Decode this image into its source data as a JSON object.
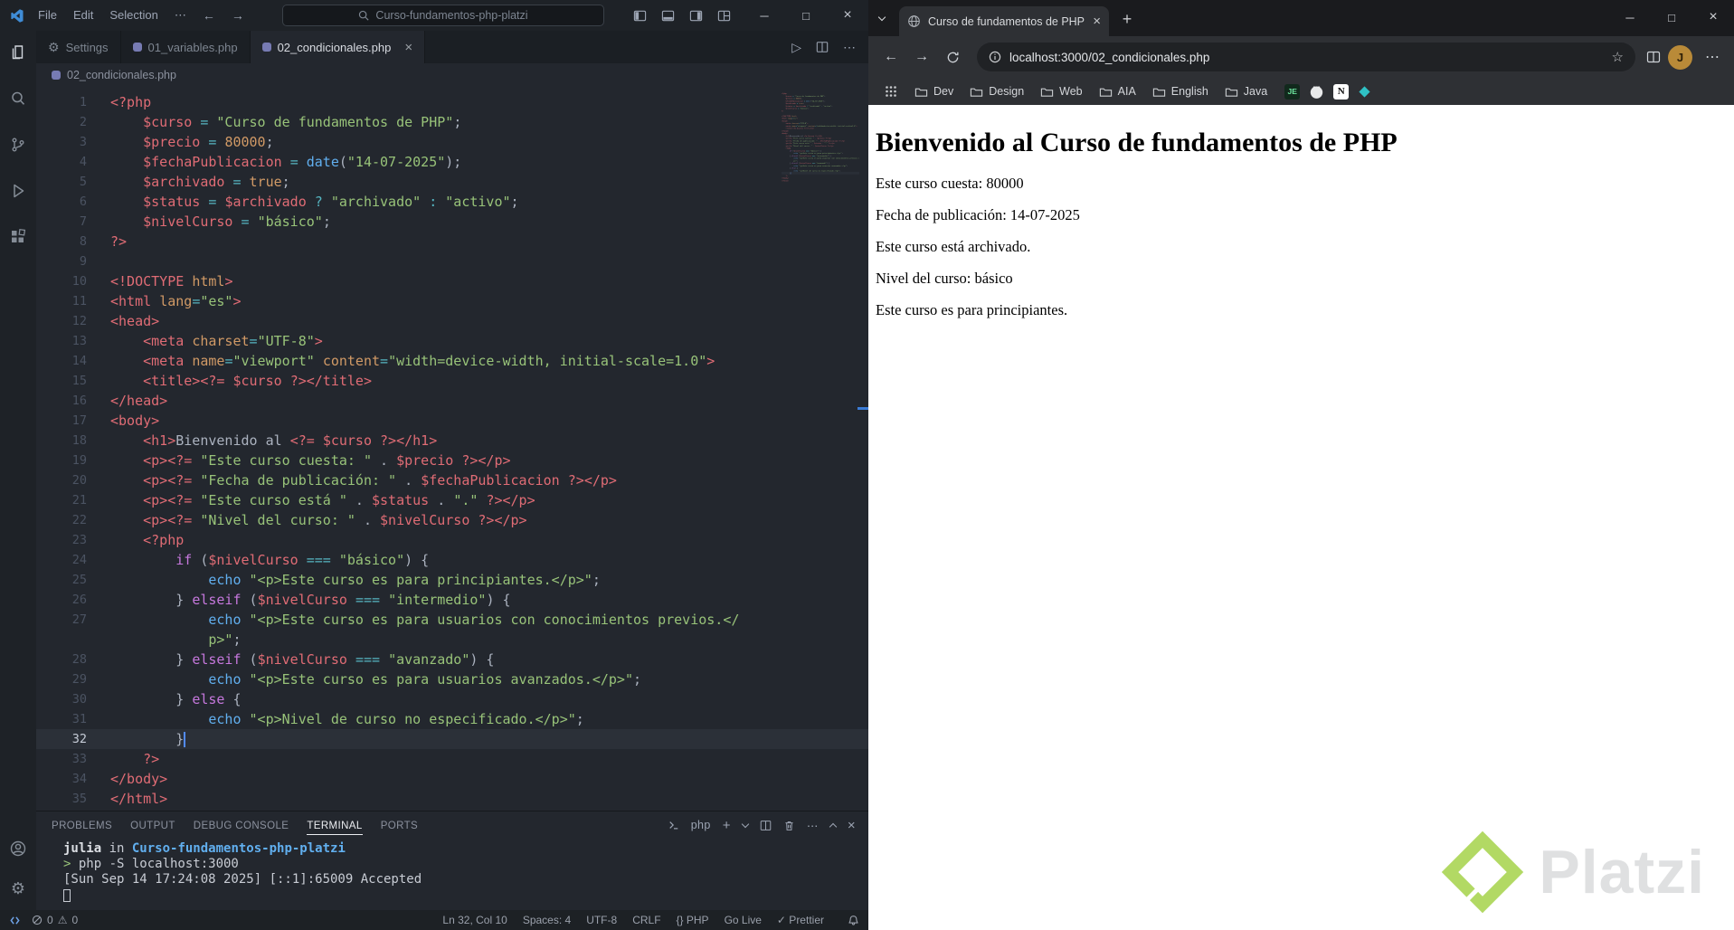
{
  "colors": {
    "platzi_green": "#b2d964",
    "php_purple": "#777bb3",
    "vscode_blue": "#3f8cd6",
    "terminal_path_blue": "#61afef"
  },
  "vscode": {
    "title_menus": [
      "File",
      "Edit",
      "Selection",
      "⋯"
    ],
    "search_box": "Curso-fundamentos-php-platzi",
    "tabs": [
      {
        "label": "Settings",
        "icon": "gear",
        "active": false
      },
      {
        "label": "01_variables.php",
        "icon": "php",
        "active": false
      },
      {
        "label": "02_condicionales.php",
        "icon": "php",
        "active": true
      }
    ],
    "breadcrumb": "02_condicionales.php",
    "code_lines": [
      {
        "n": "1",
        "tokens": [
          [
            "tag",
            "<?php"
          ]
        ]
      },
      {
        "n": "2",
        "tokens": [
          [
            "pun",
            "    "
          ],
          [
            "var",
            "$curso"
          ],
          [
            "pun",
            " "
          ],
          [
            "op",
            "="
          ],
          [
            "pun",
            " "
          ],
          [
            "str",
            "\"Curso de fundamentos de PHP\""
          ],
          [
            "pun",
            ";"
          ]
        ]
      },
      {
        "n": "3",
        "tokens": [
          [
            "pun",
            "    "
          ],
          [
            "var",
            "$precio"
          ],
          [
            "pun",
            " "
          ],
          [
            "op",
            "="
          ],
          [
            "pun",
            " "
          ],
          [
            "num",
            "80000"
          ],
          [
            "pun",
            ";"
          ]
        ]
      },
      {
        "n": "4",
        "tokens": [
          [
            "pun",
            "    "
          ],
          [
            "var",
            "$fechaPublicacion"
          ],
          [
            "pun",
            " "
          ],
          [
            "op",
            "="
          ],
          [
            "pun",
            " "
          ],
          [
            "fn",
            "date"
          ],
          [
            "pun",
            "("
          ],
          [
            "str",
            "\"14-07-2025\""
          ],
          [
            "pun",
            ");"
          ]
        ]
      },
      {
        "n": "5",
        "tokens": [
          [
            "pun",
            "    "
          ],
          [
            "var",
            "$archivado"
          ],
          [
            "pun",
            " "
          ],
          [
            "op",
            "="
          ],
          [
            "pun",
            " "
          ],
          [
            "num",
            "true"
          ],
          [
            "pun",
            ";"
          ]
        ]
      },
      {
        "n": "6",
        "tokens": [
          [
            "pun",
            "    "
          ],
          [
            "var",
            "$status"
          ],
          [
            "pun",
            " "
          ],
          [
            "op",
            "="
          ],
          [
            "pun",
            " "
          ],
          [
            "var",
            "$archivado"
          ],
          [
            "pun",
            " "
          ],
          [
            "op",
            "?"
          ],
          [
            "pun",
            " "
          ],
          [
            "str",
            "\"archivado\""
          ],
          [
            "pun",
            " "
          ],
          [
            "op",
            ":"
          ],
          [
            "pun",
            " "
          ],
          [
            "str",
            "\"activo\""
          ],
          [
            "pun",
            ";"
          ]
        ]
      },
      {
        "n": "7",
        "tokens": [
          [
            "pun",
            "    "
          ],
          [
            "var",
            "$nivelCurso"
          ],
          [
            "pun",
            " "
          ],
          [
            "op",
            "="
          ],
          [
            "pun",
            " "
          ],
          [
            "str",
            "\"básico\""
          ],
          [
            "pun",
            ";"
          ]
        ]
      },
      {
        "n": "8",
        "tokens": [
          [
            "tag",
            "?>"
          ]
        ]
      },
      {
        "n": "9",
        "tokens": []
      },
      {
        "n": "10",
        "tokens": [
          [
            "tag",
            "<!DOCTYPE "
          ],
          [
            "attr",
            "html"
          ],
          [
            "tag",
            ">"
          ]
        ]
      },
      {
        "n": "11",
        "tokens": [
          [
            "tag",
            "<html"
          ],
          [
            "pun",
            " "
          ],
          [
            "attr",
            "lang"
          ],
          [
            "op",
            "="
          ],
          [
            "str",
            "\"es\""
          ],
          [
            "tag",
            ">"
          ]
        ]
      },
      {
        "n": "12",
        "tokens": [
          [
            "tag",
            "<head>"
          ]
        ]
      },
      {
        "n": "13",
        "tokens": [
          [
            "pun",
            "    "
          ],
          [
            "tag",
            "<meta"
          ],
          [
            "pun",
            " "
          ],
          [
            "attr",
            "charset"
          ],
          [
            "op",
            "="
          ],
          [
            "str",
            "\"UTF-8\""
          ],
          [
            "tag",
            ">"
          ]
        ]
      },
      {
        "n": "14",
        "tokens": [
          [
            "pun",
            "    "
          ],
          [
            "tag",
            "<meta"
          ],
          [
            "pun",
            " "
          ],
          [
            "attr",
            "name"
          ],
          [
            "op",
            "="
          ],
          [
            "str",
            "\"viewport\""
          ],
          [
            "pun",
            " "
          ],
          [
            "attr",
            "content"
          ],
          [
            "op",
            "="
          ],
          [
            "str",
            "\"width=device-width, initial-scale=1.0\""
          ],
          [
            "tag",
            ">"
          ]
        ]
      },
      {
        "n": "15",
        "tokens": [
          [
            "pun",
            "    "
          ],
          [
            "tag",
            "<title>"
          ],
          [
            "tag",
            "<?="
          ],
          [
            "pun",
            " "
          ],
          [
            "var",
            "$curso"
          ],
          [
            "pun",
            " "
          ],
          [
            "tag",
            "?>"
          ],
          [
            "tag",
            "</title>"
          ]
        ]
      },
      {
        "n": "16",
        "tokens": [
          [
            "tag",
            "</head>"
          ]
        ]
      },
      {
        "n": "17",
        "tokens": [
          [
            "tag",
            "<body>"
          ]
        ]
      },
      {
        "n": "18",
        "tokens": [
          [
            "pun",
            "    "
          ],
          [
            "tag",
            "<h1>"
          ],
          [
            "pun",
            "Bienvenido al "
          ],
          [
            "tag",
            "<?="
          ],
          [
            "pun",
            " "
          ],
          [
            "var",
            "$curso"
          ],
          [
            "pun",
            " "
          ],
          [
            "tag",
            "?>"
          ],
          [
            "tag",
            "</h1>"
          ]
        ]
      },
      {
        "n": "19",
        "tokens": [
          [
            "pun",
            "    "
          ],
          [
            "tag",
            "<p>"
          ],
          [
            "tag",
            "<?="
          ],
          [
            "pun",
            " "
          ],
          [
            "str",
            "\"Este curso cuesta: \""
          ],
          [
            "pun",
            " . "
          ],
          [
            "var",
            "$precio"
          ],
          [
            "pun",
            " "
          ],
          [
            "tag",
            "?>"
          ],
          [
            "tag",
            "</p>"
          ]
        ]
      },
      {
        "n": "20",
        "tokens": [
          [
            "pun",
            "    "
          ],
          [
            "tag",
            "<p>"
          ],
          [
            "tag",
            "<?="
          ],
          [
            "pun",
            " "
          ],
          [
            "str",
            "\"Fecha de publicación: \""
          ],
          [
            "pun",
            " . "
          ],
          [
            "var",
            "$fechaPublicacion"
          ],
          [
            "pun",
            " "
          ],
          [
            "tag",
            "?>"
          ],
          [
            "tag",
            "</p>"
          ]
        ]
      },
      {
        "n": "21",
        "tokens": [
          [
            "pun",
            "    "
          ],
          [
            "tag",
            "<p>"
          ],
          [
            "tag",
            "<?="
          ],
          [
            "pun",
            " "
          ],
          [
            "str",
            "\"Este curso está \""
          ],
          [
            "pun",
            " . "
          ],
          [
            "var",
            "$status"
          ],
          [
            "pun",
            " . "
          ],
          [
            "str",
            "\".\""
          ],
          [
            "pun",
            " "
          ],
          [
            "tag",
            "?>"
          ],
          [
            "tag",
            "</p>"
          ]
        ]
      },
      {
        "n": "22",
        "tokens": [
          [
            "pun",
            "    "
          ],
          [
            "tag",
            "<p>"
          ],
          [
            "tag",
            "<?="
          ],
          [
            "pun",
            " "
          ],
          [
            "str",
            "\"Nivel del curso: \""
          ],
          [
            "pun",
            " . "
          ],
          [
            "var",
            "$nivelCurso"
          ],
          [
            "pun",
            " "
          ],
          [
            "tag",
            "?>"
          ],
          [
            "tag",
            "</p>"
          ]
        ]
      },
      {
        "n": "23",
        "tokens": [
          [
            "pun",
            "    "
          ],
          [
            "tag",
            "<?php"
          ]
        ]
      },
      {
        "n": "24",
        "tokens": [
          [
            "pun",
            "        "
          ],
          [
            "kw",
            "if"
          ],
          [
            "pun",
            " ("
          ],
          [
            "var",
            "$nivelCurso"
          ],
          [
            "pun",
            " "
          ],
          [
            "op",
            "==="
          ],
          [
            "pun",
            " "
          ],
          [
            "str",
            "\"básico\""
          ],
          [
            "pun",
            ") {"
          ]
        ]
      },
      {
        "n": "25",
        "tokens": [
          [
            "pun",
            "            "
          ],
          [
            "fn",
            "echo"
          ],
          [
            "pun",
            " "
          ],
          [
            "str",
            "\"<p>Este curso es para principiantes.</p>\""
          ],
          [
            "pun",
            ";"
          ]
        ]
      },
      {
        "n": "26",
        "tokens": [
          [
            "pun",
            "        } "
          ],
          [
            "kw",
            "elseif"
          ],
          [
            "pun",
            " ("
          ],
          [
            "var",
            "$nivelCurso"
          ],
          [
            "pun",
            " "
          ],
          [
            "op",
            "==="
          ],
          [
            "pun",
            " "
          ],
          [
            "str",
            "\"intermedio\""
          ],
          [
            "pun",
            ") {"
          ]
        ]
      },
      {
        "n": "27",
        "tokens": [
          [
            "pun",
            "            "
          ],
          [
            "fn",
            "echo"
          ],
          [
            "pun",
            " "
          ],
          [
            "str",
            "\"<p>Este curso es para usuarios con conocimientos previos.</"
          ]
        ]
      },
      {
        "n": "",
        "tokens": [
          [
            "pun",
            "            "
          ],
          [
            "str",
            "p>\""
          ],
          [
            "pun",
            ";"
          ]
        ]
      },
      {
        "n": "28",
        "tokens": [
          [
            "pun",
            "        } "
          ],
          [
            "kw",
            "elseif"
          ],
          [
            "pun",
            " ("
          ],
          [
            "var",
            "$nivelCurso"
          ],
          [
            "pun",
            " "
          ],
          [
            "op",
            "==="
          ],
          [
            "pun",
            " "
          ],
          [
            "str",
            "\"avanzado\""
          ],
          [
            "pun",
            ") {"
          ]
        ]
      },
      {
        "n": "29",
        "tokens": [
          [
            "pun",
            "            "
          ],
          [
            "fn",
            "echo"
          ],
          [
            "pun",
            " "
          ],
          [
            "str",
            "\"<p>Este curso es para usuarios avanzados.</p>\""
          ],
          [
            "pun",
            ";"
          ]
        ]
      },
      {
        "n": "30",
        "tokens": [
          [
            "pun",
            "        } "
          ],
          [
            "kw",
            "else"
          ],
          [
            "pun",
            " {"
          ]
        ]
      },
      {
        "n": "31",
        "tokens": [
          [
            "pun",
            "            "
          ],
          [
            "fn",
            "echo"
          ],
          [
            "pun",
            " "
          ],
          [
            "str",
            "\"<p>Nivel de curso no especificado.</p>\""
          ],
          [
            "pun",
            ";"
          ]
        ]
      },
      {
        "n": "32",
        "active": true,
        "cursor": true,
        "tokens": [
          [
            "pun",
            "        }"
          ]
        ]
      },
      {
        "n": "33",
        "tokens": [
          [
            "pun",
            "    "
          ],
          [
            "tag",
            "?>"
          ]
        ]
      },
      {
        "n": "34",
        "tokens": [
          [
            "tag",
            "</body>"
          ]
        ]
      },
      {
        "n": "35",
        "tokens": [
          [
            "tag",
            "</html>"
          ]
        ]
      }
    ],
    "panel_tabs": [
      "PROBLEMS",
      "OUTPUT",
      "DEBUG CONSOLE",
      "TERMINAL",
      "PORTS"
    ],
    "panel_active_tab": "TERMINAL",
    "terminal_profile": "php",
    "terminal_lines": [
      {
        "tokens": [
          [
            "t-user",
            "julia"
          ],
          [
            "t-plain",
            " in "
          ],
          [
            "t-path",
            "Curso-fundamentos-php-platzi"
          ]
        ]
      },
      {
        "tokens": [
          [
            "t-prompt",
            "> "
          ],
          [
            "t-plain",
            "php -S localhost:3000"
          ]
        ]
      },
      {
        "tokens": [
          [
            "t-plain",
            "[Sun Sep 14 17:24:08 2025] [::1]:65009 Accepted"
          ]
        ]
      },
      {
        "tokens": [],
        "cursor": true
      }
    ],
    "status_left": {
      "errors": "0",
      "warnings": "0"
    },
    "status_right": [
      "Ln 32, Col 10",
      "Spaces: 4",
      "UTF-8",
      "CRLF",
      "{} PHP",
      "Go Live",
      "✓ Prettier"
    ]
  },
  "browser": {
    "tab": {
      "title": "Curso de fundamentos de PHP"
    },
    "url": "localhost:3000/02_condicionales.php",
    "avatar_letter": "J",
    "bookmark_folders": [
      "Dev",
      "Design",
      "Web",
      "AIA",
      "English",
      "Java"
    ],
    "badge_je": "JE",
    "badge_notion": "N",
    "page": {
      "heading": "Bienvenido al Curso de fundamentos de PHP",
      "paragraphs": [
        "Este curso cuesta: 80000",
        "Fecha de publicación: 14-07-2025",
        "Este curso está archivado.",
        "Nivel del curso: básico",
        "Este curso es para principiantes."
      ]
    },
    "watermark_text": "Platzi"
  }
}
